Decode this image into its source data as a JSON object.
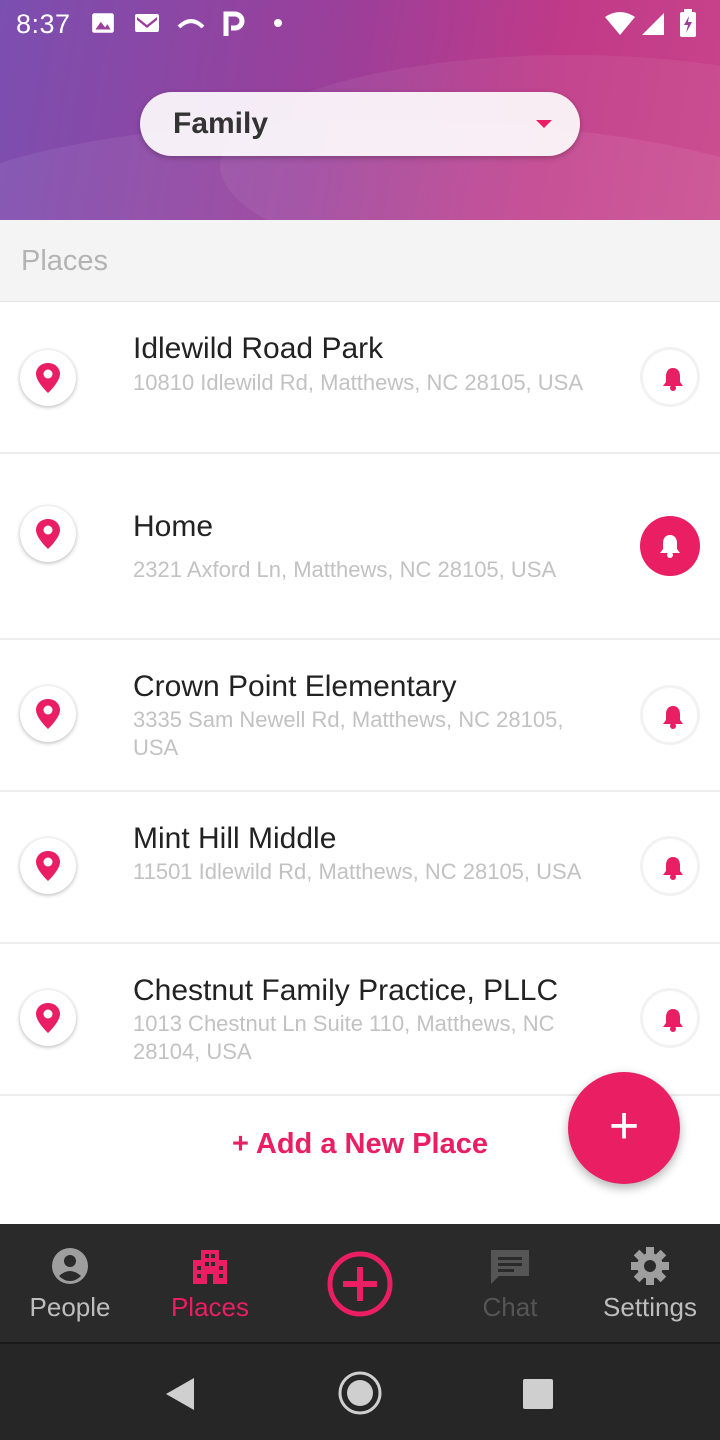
{
  "status_bar": {
    "time": "8:37",
    "left_icons": [
      "image-icon",
      "gmail-icon",
      "cast-icon",
      "parking-icon",
      "dot-icon"
    ],
    "right_icons": [
      "wifi-icon",
      "signal-icon",
      "battery-charging-icon"
    ]
  },
  "header": {
    "group_selector": {
      "value": "Family"
    }
  },
  "section": {
    "title": "Places"
  },
  "places": [
    {
      "name": "Idlewild Road Park",
      "address": "10810 Idlewild Rd, Matthews, NC 28105, USA",
      "alert_active": false
    },
    {
      "name": "Home",
      "address": "2321 Axford Ln, Matthews, NC 28105, USA",
      "alert_active": true
    },
    {
      "name": "Crown Point Elementary",
      "address": "3335 Sam Newell Rd, Matthews, NC 28105, USA",
      "alert_active": false
    },
    {
      "name": "Mint Hill Middle",
      "address": "11501 Idlewild Rd, Matthews, NC 28105, USA",
      "alert_active": false
    },
    {
      "name": "Chestnut Family Practice, PLLC",
      "address": "1013 Chestnut Ln Suite 110, Matthews, NC 28104, USA",
      "alert_active": false
    }
  ],
  "add_place_label": "+ Add a New Place",
  "fab_label": "+",
  "bottom_nav": {
    "items": [
      {
        "label": "People",
        "icon": "person-icon",
        "state": "inactive"
      },
      {
        "label": "Places",
        "icon": "building-icon",
        "state": "active"
      },
      {
        "label": "",
        "icon": "add-circle-icon",
        "state": "center"
      },
      {
        "label": "Chat",
        "icon": "chat-icon",
        "state": "disabled"
      },
      {
        "label": "Settings",
        "icon": "gear-icon",
        "state": "inactive"
      }
    ]
  },
  "system_nav": [
    "back-icon",
    "home-icon",
    "recents-icon"
  ],
  "colors": {
    "accent": "#e91e63",
    "header_gradient_start": "#7b4fb0",
    "header_gradient_end": "#c8438a",
    "nav_bg": "#2a2a2a"
  }
}
